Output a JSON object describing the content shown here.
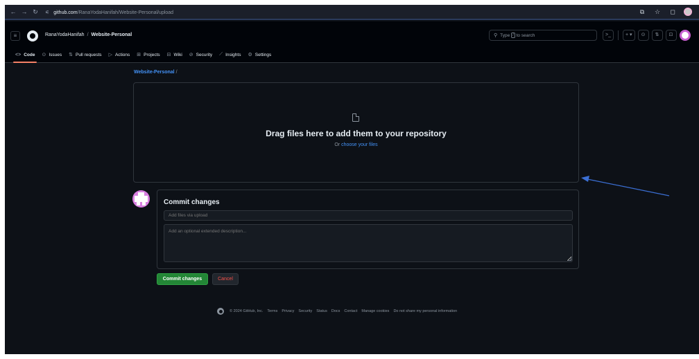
{
  "browser": {
    "url_host": "github.com",
    "url_path": "/RanaYodaHanifah/Website-Personal/upload"
  },
  "header": {
    "owner": "RanaYodaHanifah",
    "separator": "/",
    "repo": "Website-Personal",
    "search_placeholder": "Type",
    "search_key": "/",
    "search_suffix": "to search",
    "terminal_label": ">_",
    "plus_label": "+ ▾"
  },
  "tabs": [
    {
      "label": "Code",
      "icon": "code-icon",
      "glyph": "<>"
    },
    {
      "label": "Issues",
      "icon": "issue-icon",
      "glyph": "⊙"
    },
    {
      "label": "Pull requests",
      "icon": "pull-request-icon",
      "glyph": "⇅"
    },
    {
      "label": "Actions",
      "icon": "play-icon",
      "glyph": "▷"
    },
    {
      "label": "Projects",
      "icon": "table-icon",
      "glyph": "⊞"
    },
    {
      "label": "Wiki",
      "icon": "book-icon",
      "glyph": "⊟"
    },
    {
      "label": "Security",
      "icon": "shield-icon",
      "glyph": "⊘"
    },
    {
      "label": "Insights",
      "icon": "graph-icon",
      "glyph": "⟋"
    },
    {
      "label": "Settings",
      "icon": "gear-icon",
      "glyph": "⚙"
    }
  ],
  "breadcrumb": {
    "repo": "Website-Personal",
    "slash": "/"
  },
  "dropzone": {
    "title": "Drag files here to add them to your repository",
    "prefix": "Or",
    "link": "choose your files"
  },
  "commit": {
    "title": "Commit changes",
    "summary_placeholder": "Add files via upload",
    "description_placeholder": "Add an optional extended description...",
    "commit_button": "Commit changes",
    "cancel_button": "Cancel"
  },
  "footer": {
    "copyright": "© 2024 GitHub, Inc.",
    "links": [
      "Terms",
      "Privacy",
      "Security",
      "Status",
      "Docs",
      "Contact",
      "Manage cookies",
      "Do not share my personal information"
    ]
  },
  "colors": {
    "background": "#0d1117",
    "header": "#010409",
    "accent_link": "#4493f8",
    "commit_green": "#238636",
    "cancel_red": "#f85149",
    "arrow": "#3b6fd4"
  }
}
